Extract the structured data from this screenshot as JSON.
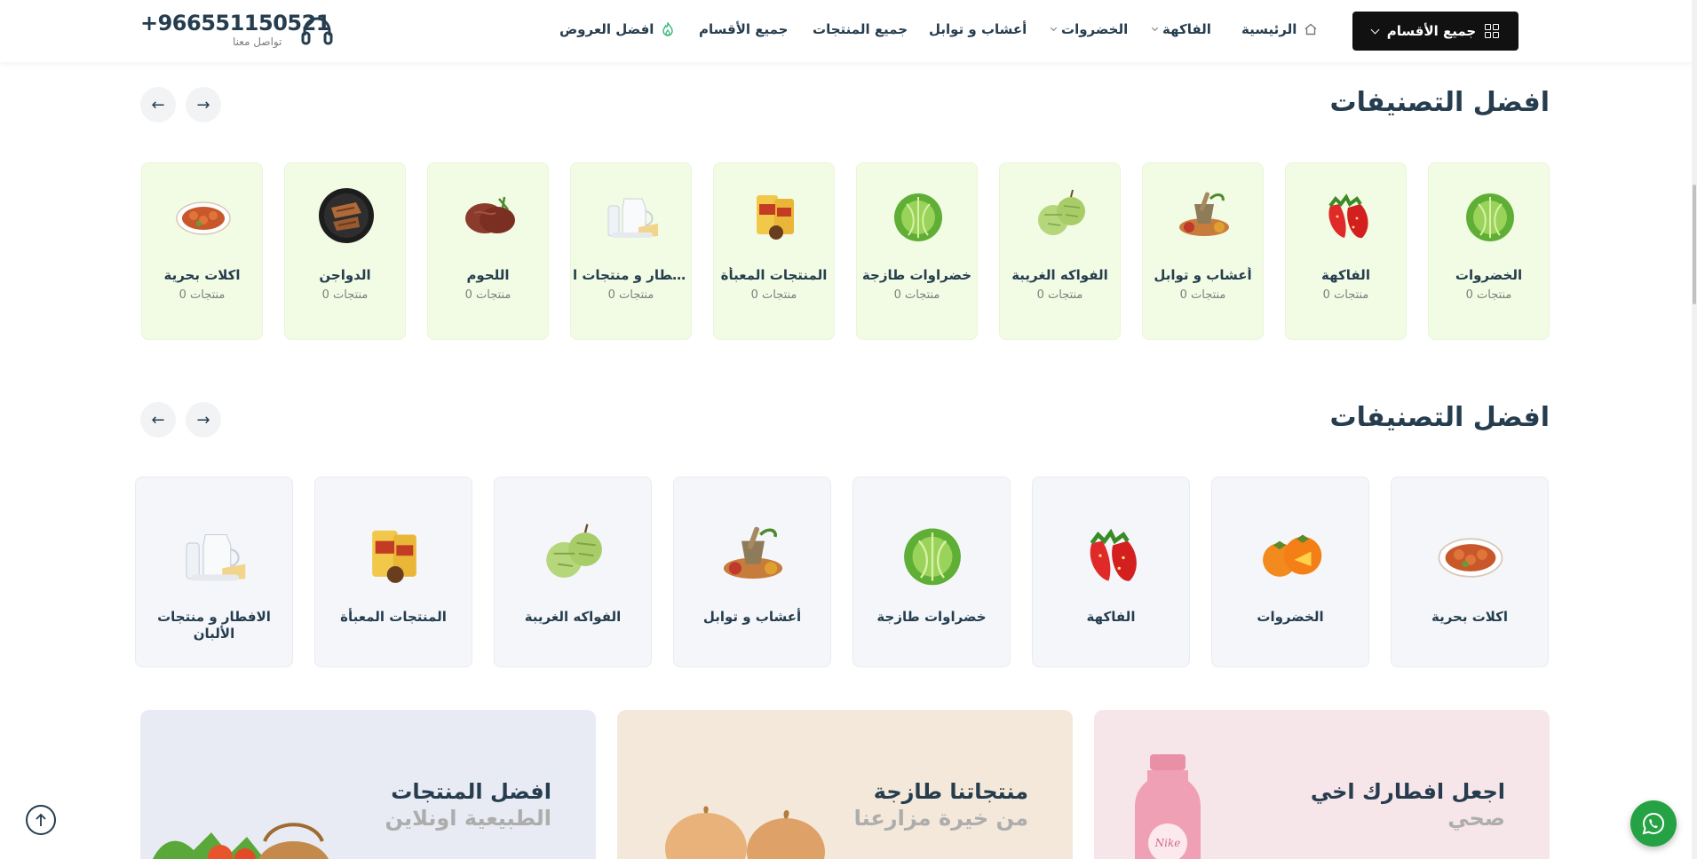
{
  "header": {
    "all_categories": "جميع الأقسام",
    "nav": {
      "home": "الرئيسية",
      "fruits": "الفاكهة",
      "vegetables": "الخضروات",
      "herbs": "أعشاب و توابل",
      "all_products": "جميع المنتجات",
      "all_sections": "جميع الأقسام",
      "best_offers": "افضل العروض"
    },
    "phone": "+966551150521",
    "contact_label": "تواصل معنا"
  },
  "section1": {
    "title": "افضل التصنيفات",
    "cards": [
      {
        "name": "الخضروات",
        "count": "0 منتجات",
        "icon": "cabbage"
      },
      {
        "name": "الفاكهة",
        "count": "0 منتجات",
        "icon": "strawberry"
      },
      {
        "name": "أعشاب و توابل",
        "count": "0 منتجات",
        "icon": "spices"
      },
      {
        "name": "الفواكه الغريبة",
        "count": "0 منتجات",
        "icon": "custard-apple"
      },
      {
        "name": "خضراوات طازجة",
        "count": "0 منتجات",
        "icon": "cabbage"
      },
      {
        "name": "المنتجات المعبأة",
        "count": "0 منتجات",
        "icon": "packaged"
      },
      {
        "name": "الافطار و منتجات ا...",
        "count": "0 منتجات",
        "icon": "dairy"
      },
      {
        "name": "اللحوم",
        "count": "0 منتجات",
        "icon": "steak"
      },
      {
        "name": "الدواجن",
        "count": "0 منتجات",
        "icon": "chicken"
      },
      {
        "name": "اكلات بحرية",
        "count": "0 منتجات",
        "icon": "shrimp"
      }
    ]
  },
  "section2": {
    "title": "افضل التصنيفات",
    "cards": [
      {
        "name": "اكلات بحرية",
        "icon": "shrimp"
      },
      {
        "name": "الخضروات",
        "icon": "persimmon"
      },
      {
        "name": "الفاكهة",
        "icon": "strawberry"
      },
      {
        "name": "خضراوات طازجة",
        "icon": "cabbage"
      },
      {
        "name": "أعشاب و توابل",
        "icon": "spices"
      },
      {
        "name": "الفواكه الغريبة",
        "icon": "custard-apple"
      },
      {
        "name": "المنتجات المعبأة",
        "icon": "packaged"
      },
      {
        "name": "الافطار و منتجات الألبان",
        "icon": "dairy"
      }
    ]
  },
  "banners": [
    {
      "line1": "اجعل افطارك اخي",
      "line2": "صحي",
      "bg": "#f7e6e9"
    },
    {
      "line1": "منتجاتنا طازجة",
      "line2": "من خيرة مزارعنا",
      "bg": "#f3e8da"
    },
    {
      "line1": "افضل المنتجات",
      "line2": "الطبيعية اونلاين",
      "bg": "#e8ebf3"
    }
  ],
  "colors": {
    "brand_dark": "#111111",
    "heading": "#253d4e",
    "card_green": "#f2fce4",
    "card_grey": "#f4f6fa",
    "whatsapp": "#25a244",
    "offer_icon": "#3bb77e"
  }
}
